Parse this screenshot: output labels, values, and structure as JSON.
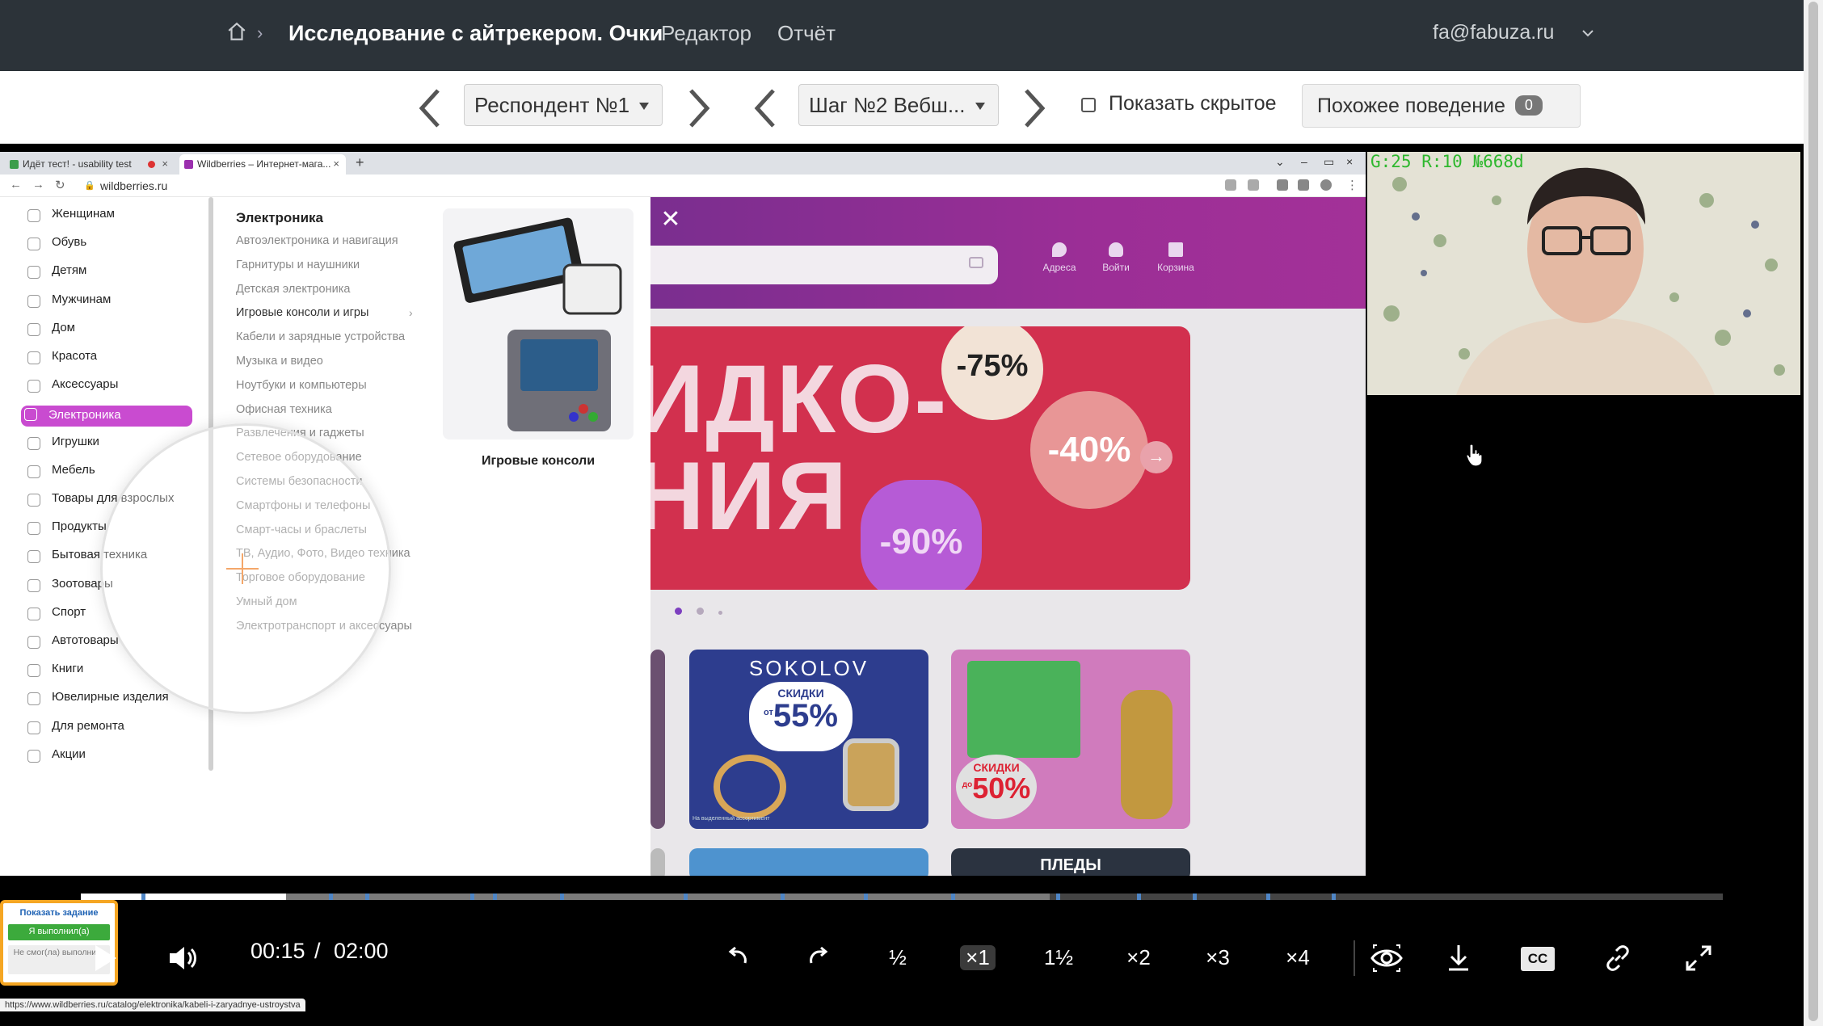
{
  "header": {
    "title": "Исследование с айтрекером. Очки",
    "nav": [
      "Редактор",
      "Отчёт"
    ],
    "user": "fa@fabuza.ru"
  },
  "controls": {
    "respondent": "Респондент №1",
    "step": "Шаг №2 Вебш...",
    "show_hidden_label": "Показать скрытое",
    "show_hidden_checked": false,
    "similar_label": "Похожее поведение",
    "similar_count": "0"
  },
  "browser": {
    "tabs": [
      {
        "title": "Идёт тест! - usability test"
      },
      {
        "title": "Wildberries – Интернет-мага..."
      }
    ],
    "url": "wildberries.ru",
    "status_url": "https://www.wildberries.ru/catalog/elektronika/kabeli-i-zaryadnye-ustroystva"
  },
  "categories": [
    "Женщинам",
    "Обувь",
    "Детям",
    "Мужчинам",
    "Дом",
    "Красота",
    "Аксессуары",
    "Электроника",
    "Игрушки",
    "Мебель",
    "Товары для взрослых",
    "Продукты",
    "Бытовая техника",
    "Зоотовары",
    "Спорт",
    "Автотовары",
    "Книги",
    "Ювелирные изделия",
    "Для ремонта",
    "Акции"
  ],
  "active_category": "Электроника",
  "submenu": {
    "title": "Электроника",
    "items": [
      "Автоэлектроника и навигация",
      "Гарнитуры и наушники",
      "Детская электроника",
      "Игровые консоли и игры",
      "Кабели и зарядные устройства",
      "Музыка и видео",
      "Ноутбуки и компьютеры",
      "Офисная техника",
      "Развлечения и гаджеты",
      "Сетевое оборудование",
      "Системы безопасности",
      "Смартфоны и телефоны",
      "Смарт-часы и браслеты",
      "ТВ, Аудио, Фото, Видео техника",
      "Торговое оборудование",
      "Умный дом",
      "Электротранспорт и аксессуары"
    ],
    "promo_caption": "Игровые консоли"
  },
  "site": {
    "icons": [
      "Адреса",
      "Войти",
      "Корзина"
    ],
    "banner_text": "ИДКО-\nНИЯ",
    "discounts": [
      "-75%",
      "-40%",
      "-90%"
    ],
    "cards": [
      {
        "brand": "SOKOLOV",
        "tag": "СКИДКИ",
        "prefix": "от",
        "value": "55%",
        "note": "На выделенный ассортимент"
      },
      {
        "tag": "СКИДКИ",
        "prefix": "до",
        "value": "50%"
      }
    ],
    "bottom_card": "ПЛЕДЫ"
  },
  "task_widget": {
    "show_task": "Показать задание",
    "done": "Я выполнил(а)",
    "failed": "Не смог(ла) выполнить"
  },
  "webcam_overlay": "G:25 R:10 №668d",
  "player": {
    "current": "00:15",
    "separator": "/",
    "duration": "02:00",
    "played_fraction": 0.125,
    "buffered_fraction": 0.59,
    "speeds": [
      "½",
      "×1",
      "1½",
      "×2",
      "×3",
      "×4"
    ],
    "active_speed": "×1",
    "cc_label": "CC"
  },
  "colors": {
    "topbar": "#2c3339",
    "wb_accent": "#c94bd0",
    "task_border": "#f5a623",
    "overlay_text": "#2eb82e"
  }
}
